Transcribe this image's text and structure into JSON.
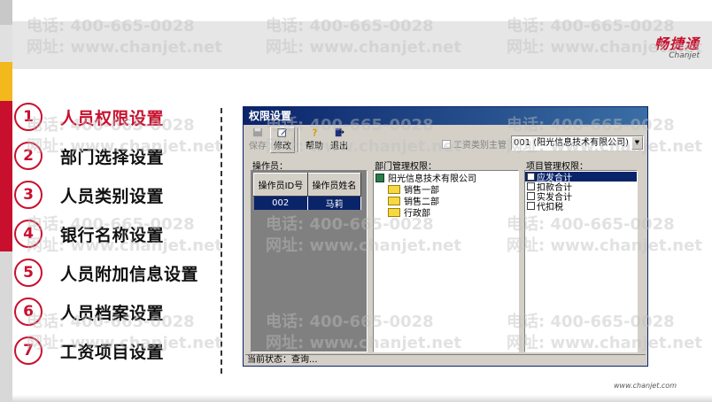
{
  "header": {
    "brand_cn": "畅捷通",
    "brand_en": "Chanjet"
  },
  "watermark": {
    "line1": "电话: 400-665-0028",
    "line2": "网址: www.chanjet.net"
  },
  "menu": {
    "items": [
      {
        "num": "1",
        "label": "人员权限设置"
      },
      {
        "num": "2",
        "label": "部门选择设置"
      },
      {
        "num": "3",
        "label": "人员类别设置"
      },
      {
        "num": "4",
        "label": "银行名称设置"
      },
      {
        "num": "5",
        "label": "人员附加信息设置"
      },
      {
        "num": "6",
        "label": "人员档案设置"
      },
      {
        "num": "7",
        "label": "工资项目设置"
      }
    ],
    "active_index": 0
  },
  "window": {
    "title": "权限设置",
    "toolbar": {
      "save": "保存",
      "edit": "修改",
      "help": "帮助",
      "exit": "退出"
    },
    "checkbox_label": "工资类别主管",
    "account_select": "001 (阳光信息技术有限公司)",
    "operator_label": "操作员：",
    "operator_table": {
      "headers": [
        "操作员ID号",
        "操作员姓名"
      ],
      "rows": [
        [
          "002",
          "马莉"
        ]
      ]
    },
    "dept_label": "部门管理权限：",
    "dept_tree": {
      "root": "阳光信息技术有限公司",
      "children": [
        "销售一部",
        "销售二部",
        "行政部"
      ]
    },
    "proj_label": "项目管理权限：",
    "proj_items": [
      "应发合计",
      "扣款合计",
      "实发合计",
      "代扣税"
    ],
    "status": "当前状态：查询..."
  },
  "footer": {
    "url": "www.chanjet.com"
  },
  "colors": {
    "accent_red": "#c8102e",
    "accent_yellow": "#f2b81c",
    "win_title": "#0a246a"
  }
}
